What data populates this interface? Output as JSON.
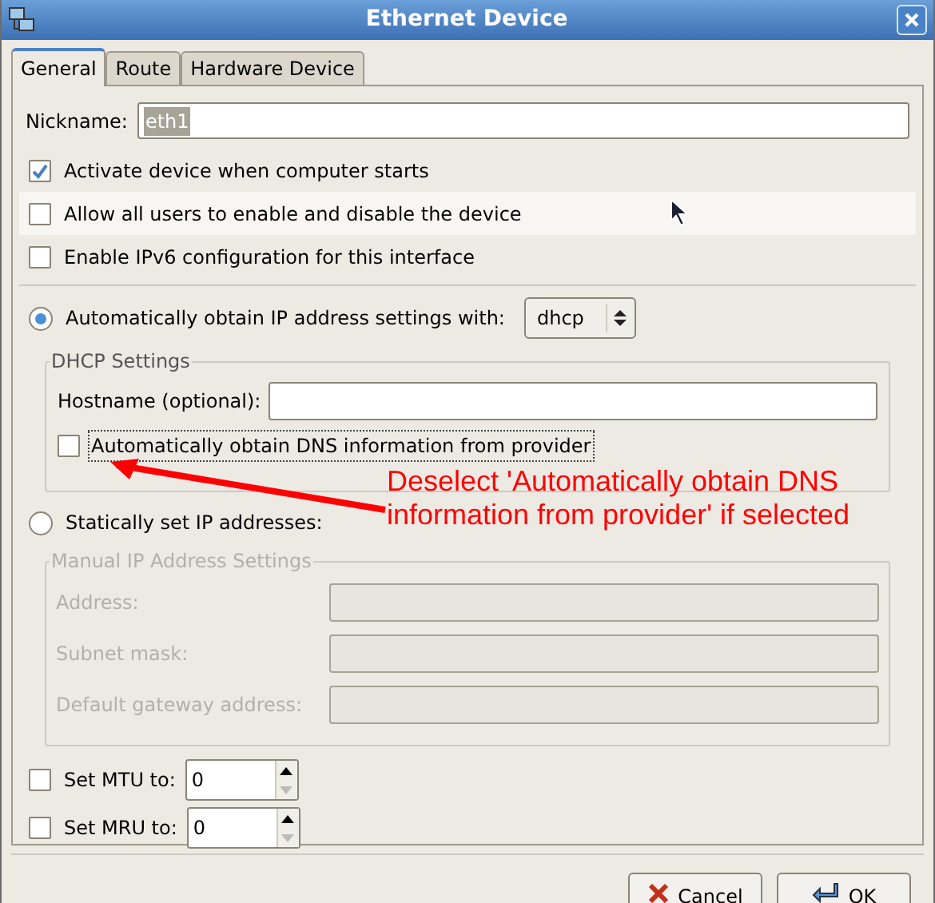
{
  "window": {
    "title": "Ethernet Device"
  },
  "tabs": [
    {
      "label": "General",
      "selected": true
    },
    {
      "label": "Route",
      "selected": false
    },
    {
      "label": "Hardware Device",
      "selected": false
    }
  ],
  "nickname": {
    "label": "Nickname:",
    "value": "eth1"
  },
  "options": [
    {
      "label": "Activate device when computer starts",
      "checked": true,
      "hovered": false
    },
    {
      "label": "Allow all users to enable and disable the device",
      "checked": false,
      "hovered": true
    },
    {
      "label": "Enable IPv6 configuration for this interface",
      "checked": false,
      "hovered": false
    }
  ],
  "auto_ip": {
    "label": "Automatically obtain IP address settings with:",
    "selected": true,
    "value": "dhcp"
  },
  "dhcp_settings": {
    "title": "DHCP Settings",
    "disabled": false,
    "hostname_label": "Hostname (optional):",
    "dns": {
      "label": "Automatically obtain DNS information from provider",
      "checked": false
    }
  },
  "static_ip": {
    "label": "Statically set IP addresses:",
    "selected": false
  },
  "manual_settings": {
    "title": "Manual IP Address Settings",
    "disabled": true,
    "fields": [
      {
        "label": "Address:"
      },
      {
        "label": "Subnet mask:"
      },
      {
        "label": "Default gateway address:"
      }
    ]
  },
  "spinners": [
    {
      "label": "Set MTU to:",
      "checked": false,
      "value": "0"
    },
    {
      "label": "Set MRU to:",
      "checked": false,
      "value": "0"
    }
  ],
  "buttons": [
    {
      "label": "Cancel",
      "kind": "cancel"
    },
    {
      "label": "OK",
      "kind": "ok"
    }
  ],
  "annotation": {
    "text": "Deselect 'Automatically obtain DNS information from provider' if selected"
  }
}
